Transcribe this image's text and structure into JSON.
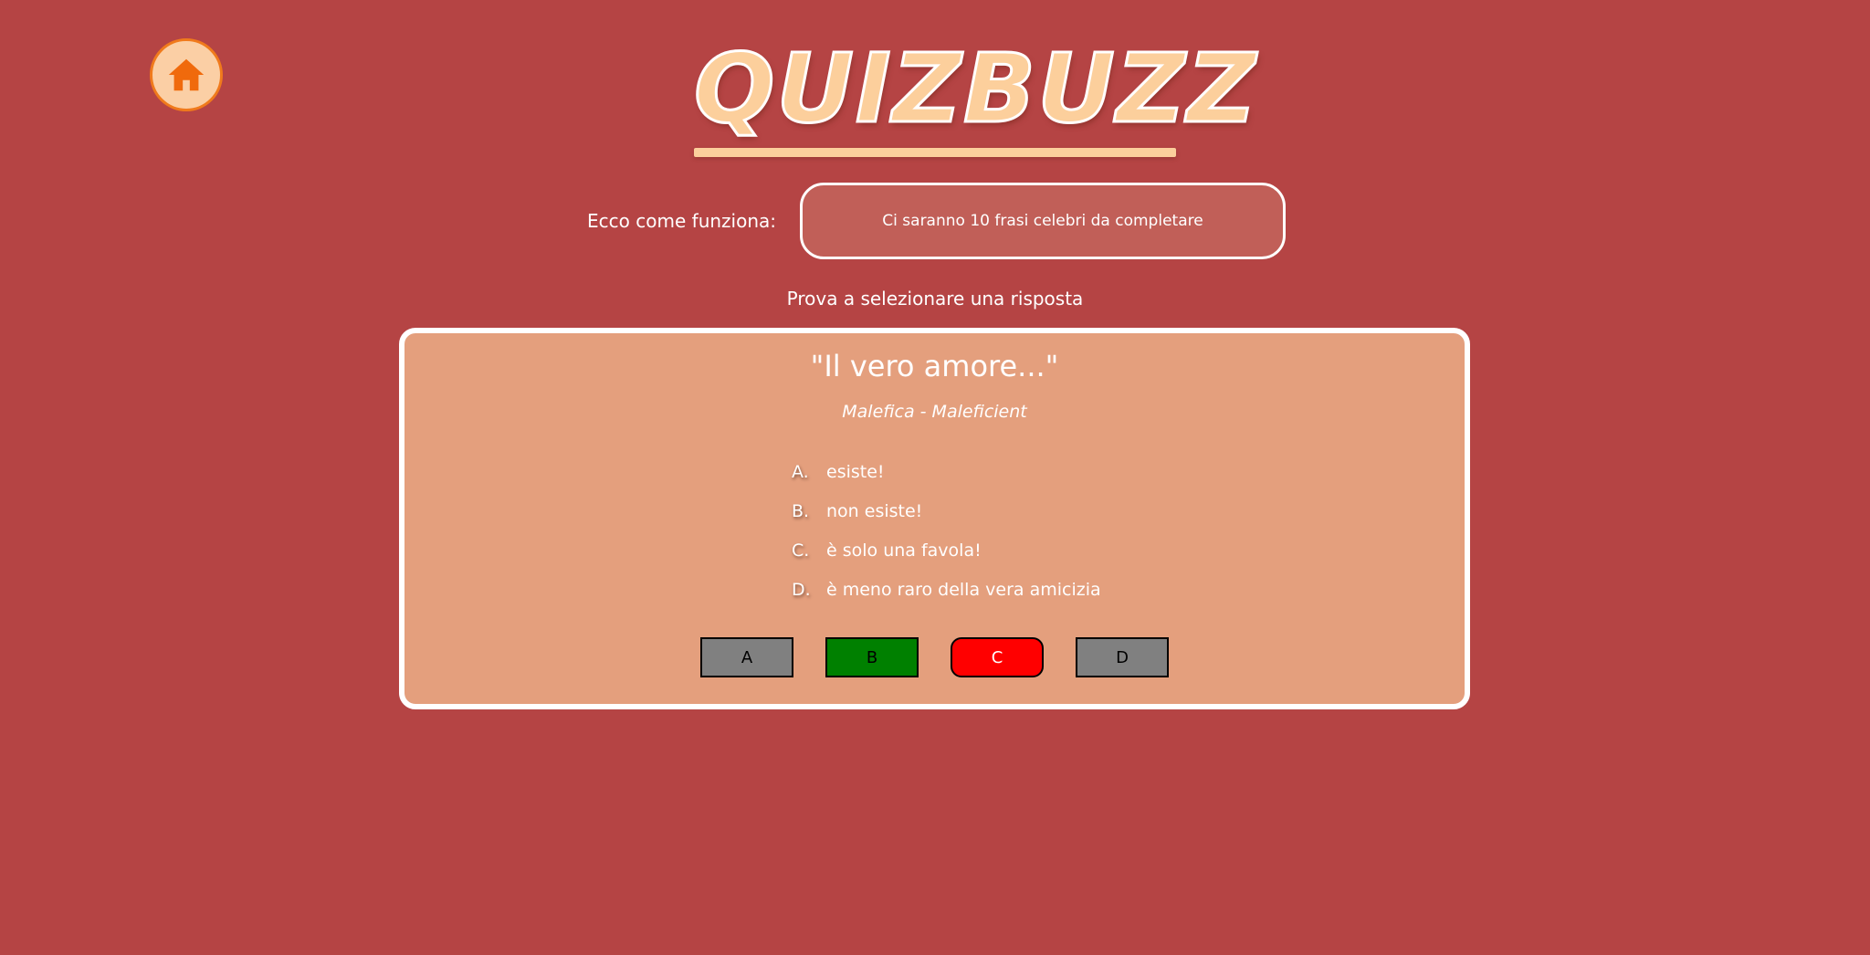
{
  "header": {
    "home_icon": "home-icon",
    "logo_text": "QUIZBUZZ"
  },
  "howto": {
    "label": "Ecco come funziona:",
    "message": "Ci saranno 10 frasi celebri da completare"
  },
  "prompt": "Prova a selezionare una risposta",
  "quiz": {
    "quote": "\"Il vero amore...\"",
    "source": "Malefica - Maleficient",
    "options": [
      {
        "letter": "A.",
        "text": "esiste!"
      },
      {
        "letter": "B.",
        "text": "non esiste!"
      },
      {
        "letter": "C.",
        "text": "è solo una favola!"
      },
      {
        "letter": "D.",
        "text": "è meno raro della vera amicizia"
      }
    ],
    "answers": [
      {
        "label": "A",
        "state": "neutral"
      },
      {
        "label": "B",
        "state": "correct"
      },
      {
        "label": "C",
        "state": "wrong"
      },
      {
        "label": "D",
        "state": "neutral"
      }
    ]
  },
  "colors": {
    "background": "#b54444",
    "card": "#e49f7d",
    "logo": "#fccf9c",
    "correct": "#008000",
    "wrong": "#ff0000",
    "neutral": "#808080"
  }
}
